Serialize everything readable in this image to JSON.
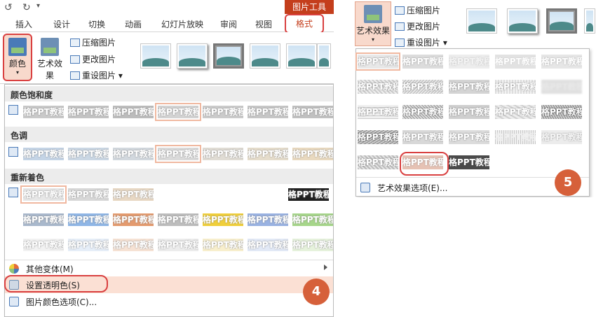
{
  "qat": {
    "undo_icon": "undo-icon",
    "repeat_icon": "repeat-icon"
  },
  "context_tab_group": "图片工具",
  "tabs": [
    {
      "label": "插入"
    },
    {
      "label": "设计"
    },
    {
      "label": "切换"
    },
    {
      "label": "动画"
    },
    {
      "label": "幻灯片放映"
    },
    {
      "label": "审阅"
    },
    {
      "label": "视图"
    }
  ],
  "active_tab": "格式",
  "ribbon": {
    "color_btn": "颜色",
    "art_effect_btn": "艺术效果",
    "compress": "压缩图片",
    "change": "更改图片",
    "reset": "重设图片"
  },
  "color_menu": {
    "sat_header": "颜色饱和度",
    "tone_header": "色调",
    "recolor_header": "重新着色",
    "swatch_text": "格PPT教程",
    "more_variants": "其他变体(M)",
    "set_transparent": "设置透明色(S)",
    "picture_color_options": "图片颜色选项(C)..."
  },
  "art_menu": {
    "swatch_text": "格PPT教程",
    "options": "艺术效果选项(E)..."
  },
  "badges": {
    "left": "4",
    "right": "5"
  },
  "colors": {
    "accent": "#c43e1c",
    "highlight": "#d94040",
    "badge": "#d6603a"
  }
}
